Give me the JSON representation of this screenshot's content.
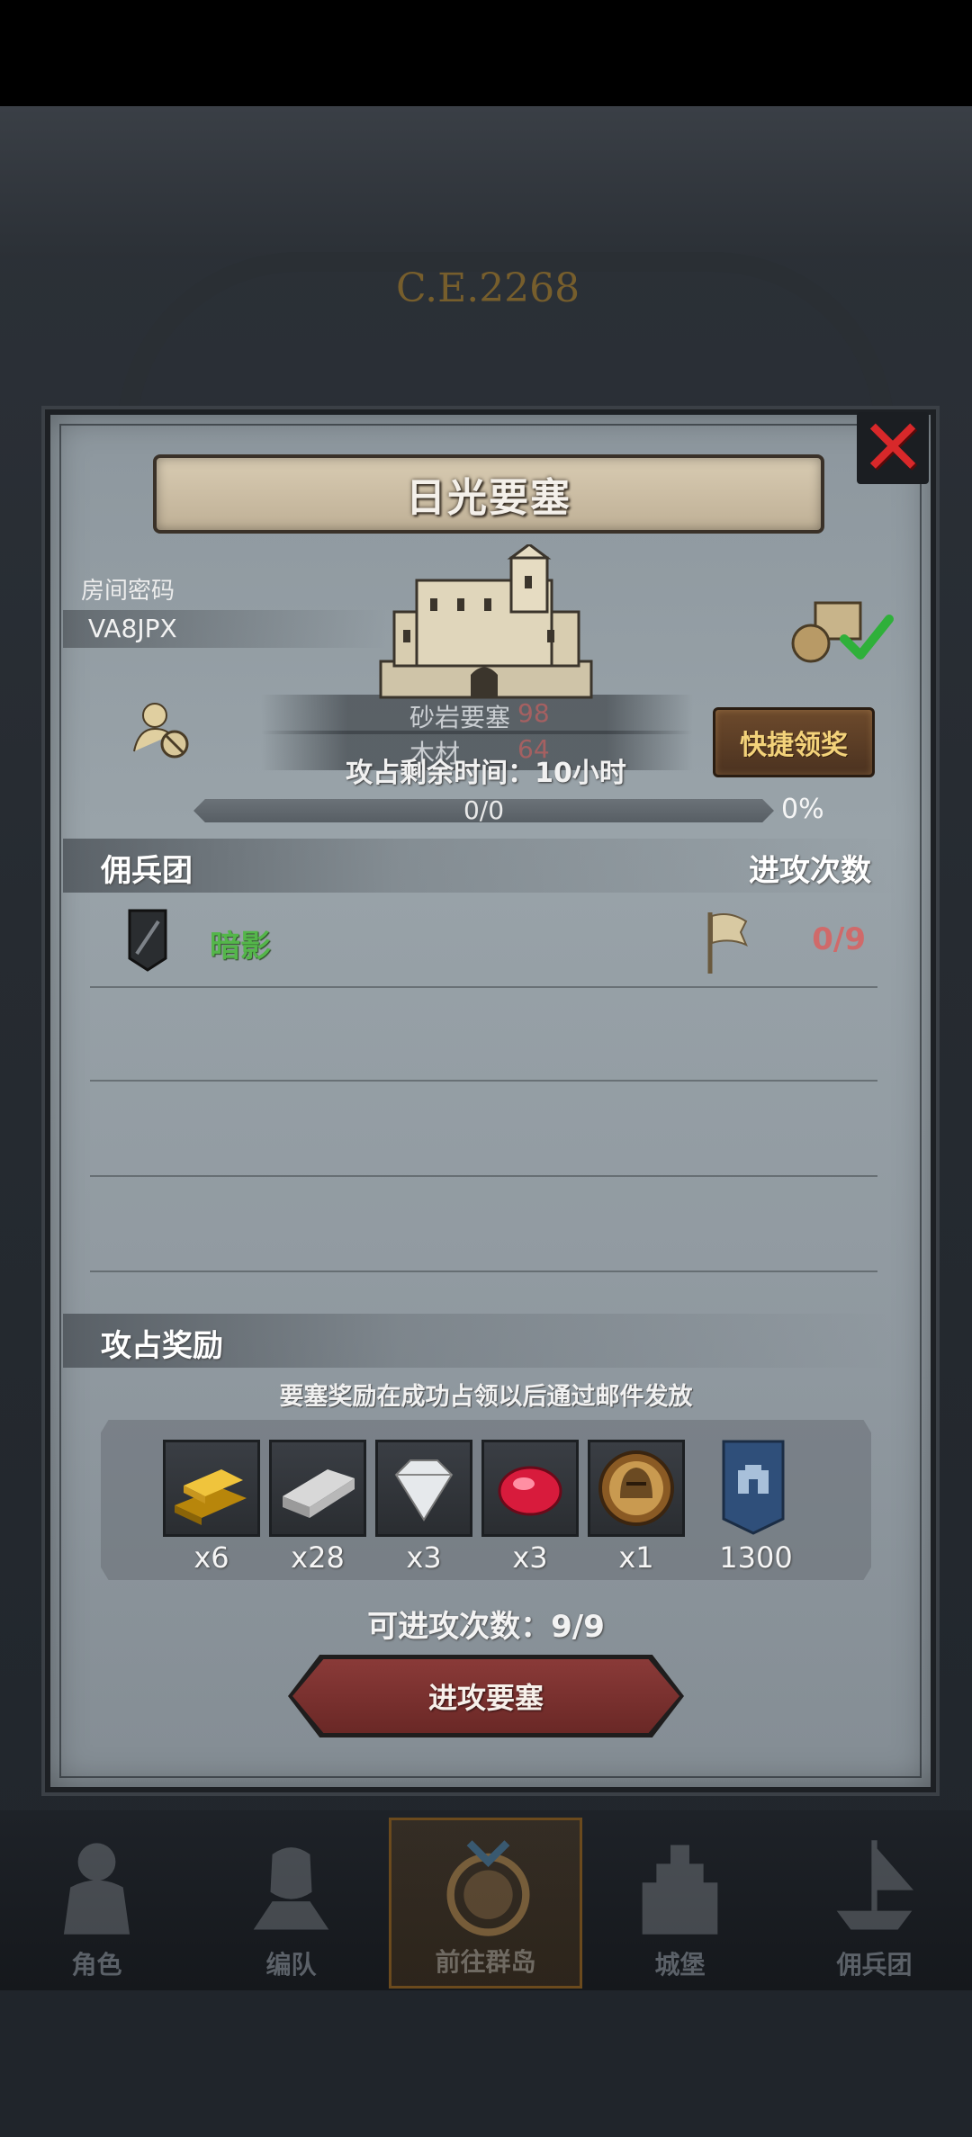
{
  "background": {
    "era": "C.E.2268"
  },
  "dialog": {
    "title": "日光要塞",
    "room_label": "房间密码",
    "room_code": "VA8JPX",
    "resources": [
      {
        "name": "砂岩要塞",
        "value": "98"
      },
      {
        "name": "木材",
        "value": "64"
      }
    ],
    "remaining_time": "攻占剩余时间：10小时",
    "quick_claim_label": "快捷领奖",
    "progress": {
      "text": "0/0",
      "percent": "0%",
      "fraction": 0
    },
    "mercenary_header": "佣兵团",
    "attack_count_header": "进攻次数",
    "mercenaries": [
      {
        "name": "暗影",
        "count": "0/9"
      }
    ],
    "reward_header": "攻占奖励",
    "reward_note": "要塞奖励在成功占领以后通过邮件发放",
    "rewards": [
      {
        "icon": "gold-bar-icon",
        "count": "x6"
      },
      {
        "icon": "iron-bar-icon",
        "count": "x28"
      },
      {
        "icon": "diamond-icon",
        "count": "x3"
      },
      {
        "icon": "ruby-icon",
        "count": "x3"
      },
      {
        "icon": "knight-helmet-coin-icon",
        "count": "x1"
      },
      {
        "icon": "castle-banner-icon",
        "count": "1300"
      }
    ],
    "attempts_text": "可进攻次数：9/9",
    "attack_button": "进攻要塞"
  },
  "nav": [
    {
      "label": "角色",
      "icon": "character-icon"
    },
    {
      "label": "编队",
      "icon": "formation-icon"
    },
    {
      "label": "前往群岛",
      "icon": "islands-icon",
      "active": true
    },
    {
      "label": "城堡",
      "icon": "castle-icon"
    },
    {
      "label": "佣兵团",
      "icon": "mercenary-ship-icon"
    }
  ],
  "colors": {
    "accent_green": "#54b64a",
    "close_red": "#d8282a",
    "count_red": "#d06a6a",
    "button_gold": "#f3d27a"
  }
}
